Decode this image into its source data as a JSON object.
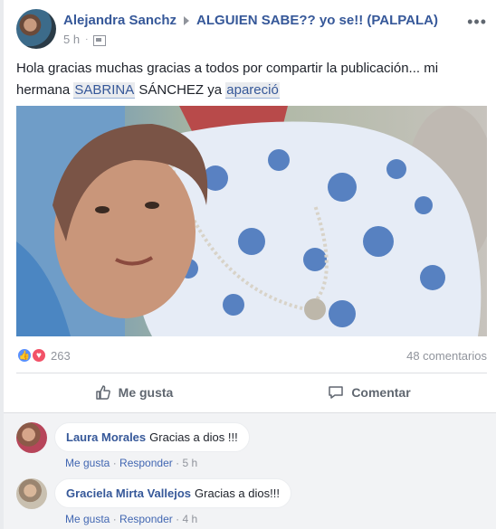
{
  "post": {
    "author": "Alejandra Sanchz",
    "group": "ALGUIEN SABE?? yo se!! (PALPALA)",
    "time": "5 h",
    "more_icon": "more-dots-icon",
    "text_before": "Hola gracias muchas gracias a todos por compartir la publicación... mi hermana ",
    "mention_1": "SABRINA",
    "text_middle": " SÁNCHEZ ya ",
    "mention_2": "apareció",
    "reaction_count": "263",
    "comments_count": "48 comentarios",
    "like_label": "Me gusta",
    "comment_label": "Comentar"
  },
  "comments": [
    {
      "author": "Laura Morales",
      "text": "Gracias a dios !!!",
      "like": "Me gusta",
      "reply": "Responder",
      "time": "5 h"
    },
    {
      "author": "Graciela Mirta Vallejos",
      "text": "Gracias a dios!!!",
      "like": "Me gusta",
      "reply": "Responder",
      "time": "4 h"
    }
  ],
  "colors": {
    "link": "#365899",
    "like_reaction": "#5890ff",
    "love_reaction": "#f25268"
  }
}
